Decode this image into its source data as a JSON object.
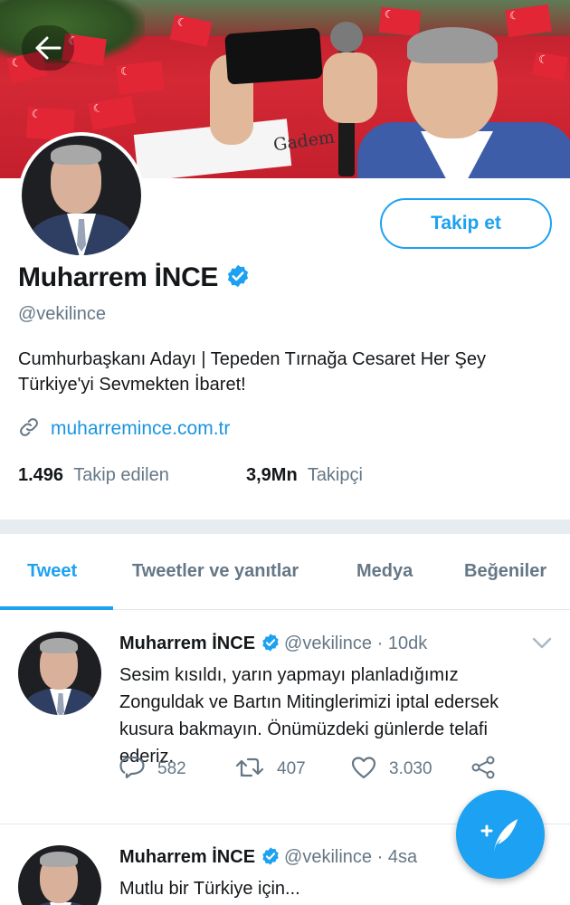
{
  "profile": {
    "name": "Muharrem İNCE",
    "handle": "@vekilince",
    "bio": "Cumhurbaşkanı Adayı | Tepeden Tırnağa Cesaret Her Şey Türkiye'yi Sevmekten İbaret!",
    "website": "muharremince.com.tr",
    "following_count": "1.496",
    "following_label": "Takip edilen",
    "followers_count": "3,9Mn",
    "followers_label": "Takipçi",
    "follow_button": "Takip et"
  },
  "banner": {
    "sign_text": "Gadem"
  },
  "tabs": [
    {
      "label": "Tweet",
      "active": true
    },
    {
      "label": "Tweetler ve yanıtlar",
      "active": false
    },
    {
      "label": "Medya",
      "active": false
    },
    {
      "label": "Beğeniler",
      "active": false
    }
  ],
  "tweets": [
    {
      "name": "Muharrem İNCE",
      "handle": "@vekilince",
      "time": "· 10dk",
      "text": "Sesim kısıldı, yarın yapmayı planladığımız Zonguldak ve Bartın Mitinglerimizi iptal edersek kusura bakmayın. Önümüzdeki günlerde telafi ederiz.",
      "replies": "582",
      "retweets": "407",
      "likes": "3.030"
    },
    {
      "name": "Muharrem İNCE",
      "handle": "@vekilince",
      "time": "· 4sa",
      "text": "Mutlu bir Türkiye için..."
    }
  ],
  "colors": {
    "accent": "#1da1f2",
    "link": "#1b95e0",
    "secondary_text": "#657786",
    "primary_text": "#14171a"
  },
  "icons": {
    "back": "arrow-left-icon",
    "verified": "verified-badge-icon",
    "link": "link-icon",
    "reply": "reply-icon",
    "retweet": "retweet-icon",
    "like": "heart-icon",
    "share": "share-icon",
    "compose": "compose-tweet-icon"
  }
}
